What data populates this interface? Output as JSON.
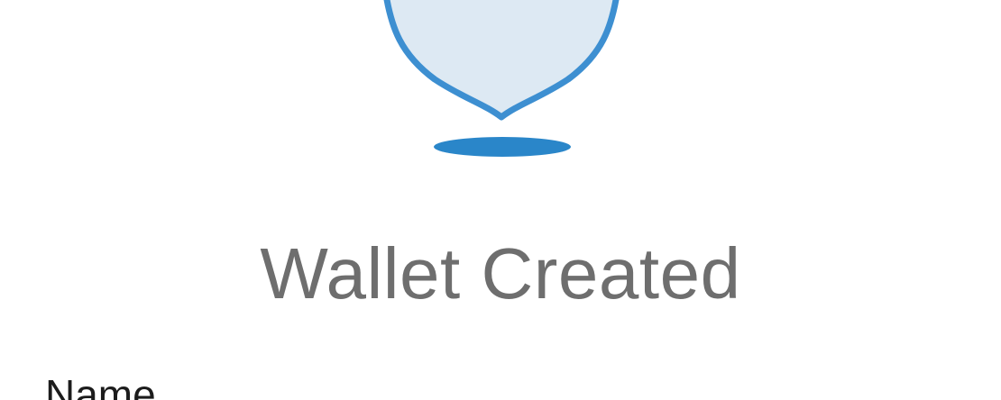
{
  "success": {
    "illustration": "shield-check-icon",
    "title": "Wallet Created"
  },
  "form": {
    "name_label": "Name"
  },
  "colors": {
    "shield_fill": "#dde9f3",
    "shield_stroke": "#3d8fd1",
    "shadow": "#2a86c9",
    "title_text": "#6e6e6e",
    "label_text": "#1c1c1c",
    "background": "#ffffff"
  }
}
